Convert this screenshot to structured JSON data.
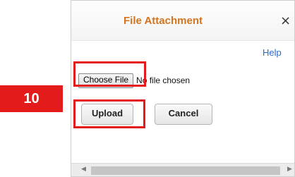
{
  "dialog": {
    "title": "File Attachment",
    "close_glyph": "×",
    "help_label": "Help",
    "choose_file_label": "Choose File",
    "file_status": "No file chosen",
    "upload_label": "Upload",
    "cancel_label": "Cancel",
    "title_color": "#d2751f"
  },
  "annotation": {
    "step_number": "10",
    "color": "#e41b1b"
  },
  "icons": {
    "close": "close-icon",
    "scroll_left": "scroll-left-arrow-icon",
    "scroll_right": "scroll-right-arrow-icon"
  },
  "scrollbar": {
    "left_glyph": "◀",
    "right_glyph": "▶"
  }
}
